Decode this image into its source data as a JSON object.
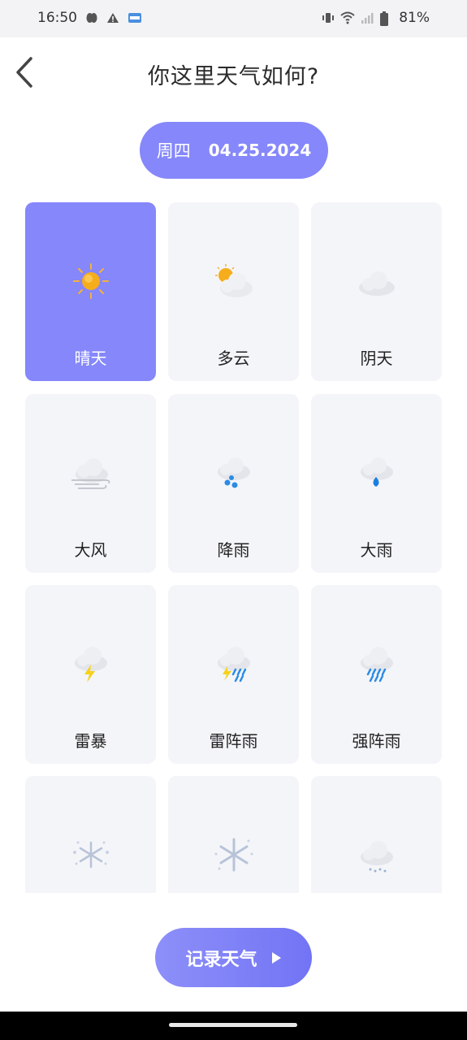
{
  "status_bar": {
    "time": "16:50",
    "battery": "81%",
    "icons": [
      "notification-leaf-icon",
      "warning-icon",
      "app-badge-icon",
      "vibrate-icon",
      "wifi-icon",
      "signal-icon",
      "battery-icon"
    ]
  },
  "header": {
    "title": "你这里天气如何?",
    "back_icon": "chevron-left-icon"
  },
  "date_selector": {
    "weekday": "周四",
    "date": "04.25.2024"
  },
  "weather_options": [
    {
      "label": "晴天",
      "icon": "sunny-icon",
      "selected": true
    },
    {
      "label": "多云",
      "icon": "partly-cloudy-icon",
      "selected": false
    },
    {
      "label": "阴天",
      "icon": "overcast-icon",
      "selected": false
    },
    {
      "label": "大风",
      "icon": "windy-icon",
      "selected": false
    },
    {
      "label": "降雨",
      "icon": "rain-icon",
      "selected": false
    },
    {
      "label": "大雨",
      "icon": "heavy-rain-icon",
      "selected": false
    },
    {
      "label": "雷暴",
      "icon": "thunderstorm-icon",
      "selected": false
    },
    {
      "label": "雷阵雨",
      "icon": "thunder-shower-icon",
      "selected": false
    },
    {
      "label": "强阵雨",
      "icon": "strong-shower-icon",
      "selected": false
    },
    {
      "label": "",
      "icon": "snow-icon",
      "selected": false
    },
    {
      "label": "",
      "icon": "snowflake-icon",
      "selected": false
    },
    {
      "label": "",
      "icon": "sleet-icon",
      "selected": false
    }
  ],
  "record_button": {
    "label": "记录天气",
    "icon": "play-arrow-icon"
  },
  "colors": {
    "accent": "#8587fb",
    "card_bg": "#f4f5f9"
  }
}
